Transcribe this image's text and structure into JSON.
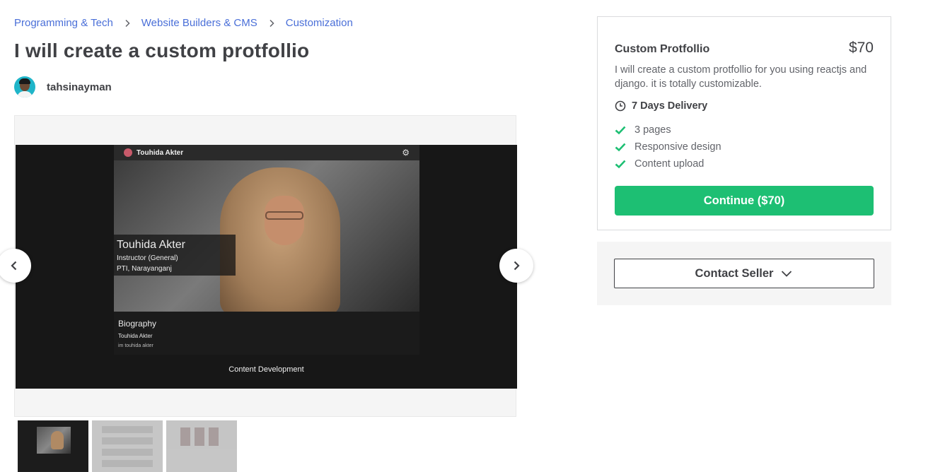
{
  "breadcrumb": {
    "items": [
      "Programming & Tech",
      "Website Builders & CMS",
      "Customization"
    ]
  },
  "gig": {
    "title": "I will create a custom protfollio"
  },
  "seller": {
    "username": "tahsinayman"
  },
  "gallery": {
    "slide": {
      "header_name": "Touhida Akter",
      "card_name": "Touhida Akter",
      "card_line1": "Instructor (General)",
      "card_line2": "PTI, Narayanganj",
      "bio_title": "Biography",
      "bio_name": "Touhida Akter",
      "bio_text": "im touhida akter",
      "caption": "Content Development"
    },
    "thumbnail_count": 3,
    "active_thumbnail": 1
  },
  "package": {
    "title": "Custom Protfollio",
    "price": "$70",
    "description": "I will create a custom protfollio for you using reactjs and django. it is totally customizable.",
    "delivery": "7 Days Delivery",
    "features": [
      "3 pages",
      "Responsive design",
      "Content upload"
    ],
    "continue_label": "Continue ($70)"
  },
  "contact": {
    "label": "Contact Seller"
  },
  "colors": {
    "link": "#4a6fd8",
    "accent_green": "#1dbf73",
    "text_dark": "#404145",
    "text_muted": "#62646a"
  },
  "icons": [
    "chevron-right-icon",
    "clock-icon",
    "check-icon",
    "chevron-down-icon",
    "arrow-left-icon",
    "arrow-right-icon",
    "gear-icon"
  ]
}
